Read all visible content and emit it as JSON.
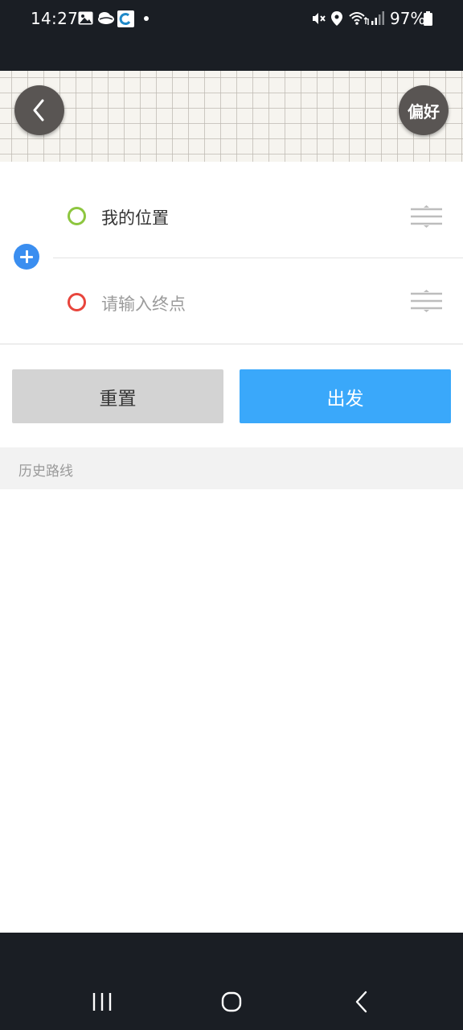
{
  "status_bar": {
    "time": "14:27",
    "battery": "97%",
    "left_icons": [
      "gallery-icon",
      "cloud-icon",
      "app-icon",
      "notification-dot-icon"
    ],
    "right_icons": [
      "mute-icon",
      "location-icon",
      "wifi-icon",
      "signal-icon",
      "battery-icon"
    ]
  },
  "header": {
    "preferences_label": "偏好"
  },
  "route": {
    "origin": "我的位置",
    "destination_placeholder": "请输入终点",
    "origin_color": "#8dc63f",
    "destination_color": "#e8453c"
  },
  "actions": {
    "reset_label": "重置",
    "go_label": "出发",
    "go_color": "#3aa8fa"
  },
  "history": {
    "title": "历史路线",
    "items": []
  }
}
